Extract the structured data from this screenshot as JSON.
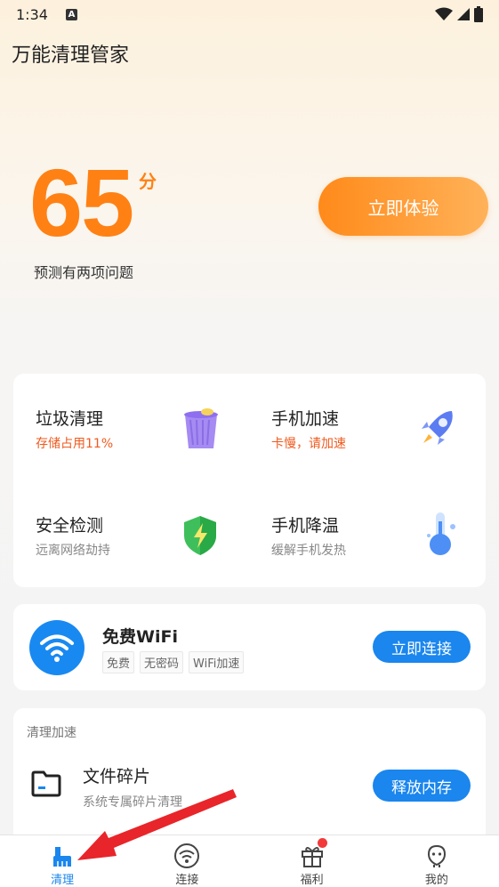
{
  "status_bar": {
    "time": "1:34",
    "notification_icon": "A"
  },
  "app": {
    "title": "万能清理管家"
  },
  "score": {
    "value": "65",
    "unit": "分",
    "description": "预测有两项问题"
  },
  "try_button": {
    "label": "立即体验"
  },
  "tools": [
    {
      "title": "垃圾清理",
      "subtitle": "存储占用11%",
      "subtitle_color": "#f05a1e",
      "icon": "trash-bin-icon"
    },
    {
      "title": "手机加速",
      "subtitle": "卡慢，请加速",
      "subtitle_color": "#f05a1e",
      "icon": "rocket-icon"
    },
    {
      "title": "安全检测",
      "subtitle": "远离网络劫持",
      "subtitle_color": "#888888",
      "icon": "shield-icon"
    },
    {
      "title": "手机降温",
      "subtitle": "缓解手机发热",
      "subtitle_color": "#888888",
      "icon": "thermometer-icon"
    }
  ],
  "wifi": {
    "title": "免费WiFi",
    "tags": [
      "免费",
      "无密码",
      "WiFi加速"
    ],
    "button": "立即连接"
  },
  "clean_section": {
    "label": "清理加速",
    "item": {
      "title": "文件碎片",
      "subtitle": "系统专属碎片清理",
      "button": "释放内存"
    }
  },
  "nav": [
    {
      "label": "清理",
      "icon": "broom-icon",
      "active": true
    },
    {
      "label": "连接",
      "icon": "wifi-icon",
      "active": false
    },
    {
      "label": "福利",
      "icon": "gift-icon",
      "active": false,
      "badge": true
    },
    {
      "label": "我的",
      "icon": "profile-icon",
      "active": false
    }
  ],
  "colors": {
    "accent_orange": "#ff8114",
    "accent_blue": "#1a86ee",
    "arrow_red": "#e8252a"
  }
}
